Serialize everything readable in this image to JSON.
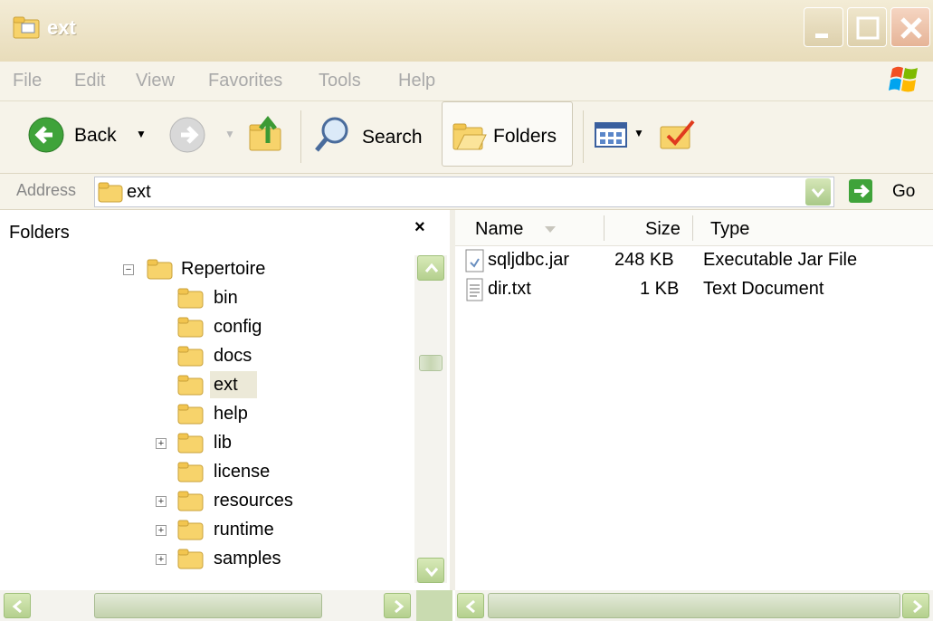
{
  "window": {
    "title": "ext",
    "minimize_label": "Minimize",
    "maximize_label": "Maximize",
    "close_label": "Close"
  },
  "menu": {
    "items": [
      "File",
      "Edit",
      "View",
      "Favorites",
      "Tools",
      "Help"
    ]
  },
  "toolbar": {
    "back_label": "Back",
    "search_label": "Search",
    "folders_label": "Folders"
  },
  "address": {
    "label": "Address",
    "value": "ext",
    "go_label": "Go"
  },
  "folders_pane": {
    "title": "Folders",
    "close_symbol": "×",
    "tree": [
      {
        "label": "Repertoire",
        "expander": "−",
        "level": 0
      },
      {
        "label": "bin",
        "expander": "",
        "level": 1
      },
      {
        "label": "config",
        "expander": "",
        "level": 1
      },
      {
        "label": "docs",
        "expander": "",
        "level": 1
      },
      {
        "label": "ext",
        "expander": "",
        "level": 1,
        "selected": true
      },
      {
        "label": "help",
        "expander": "",
        "level": 1
      },
      {
        "label": "lib",
        "expander": "+",
        "level": 1
      },
      {
        "label": "license",
        "expander": "",
        "level": 1
      },
      {
        "label": "resources",
        "expander": "+",
        "level": 1
      },
      {
        "label": "runtime",
        "expander": "+",
        "level": 1
      },
      {
        "label": "samples",
        "expander": "+",
        "level": 1
      }
    ]
  },
  "file_list": {
    "columns": {
      "name": "Name",
      "size": "Size",
      "type": "Type"
    },
    "files": [
      {
        "name": "sqljdbc.jar",
        "size": "248 KB",
        "type": "Executable Jar File",
        "icon": "jar-file-icon"
      },
      {
        "name": "dir.txt",
        "size": "1 KB",
        "type": "Text Document",
        "icon": "text-file-icon"
      }
    ]
  },
  "colors": {
    "titlebar": "#e8dcba",
    "chrome": "#f6f3e9",
    "scroll_green": "#b4d08e",
    "selection": "#ece9d8",
    "folder_yellow": "#f7d36b"
  }
}
